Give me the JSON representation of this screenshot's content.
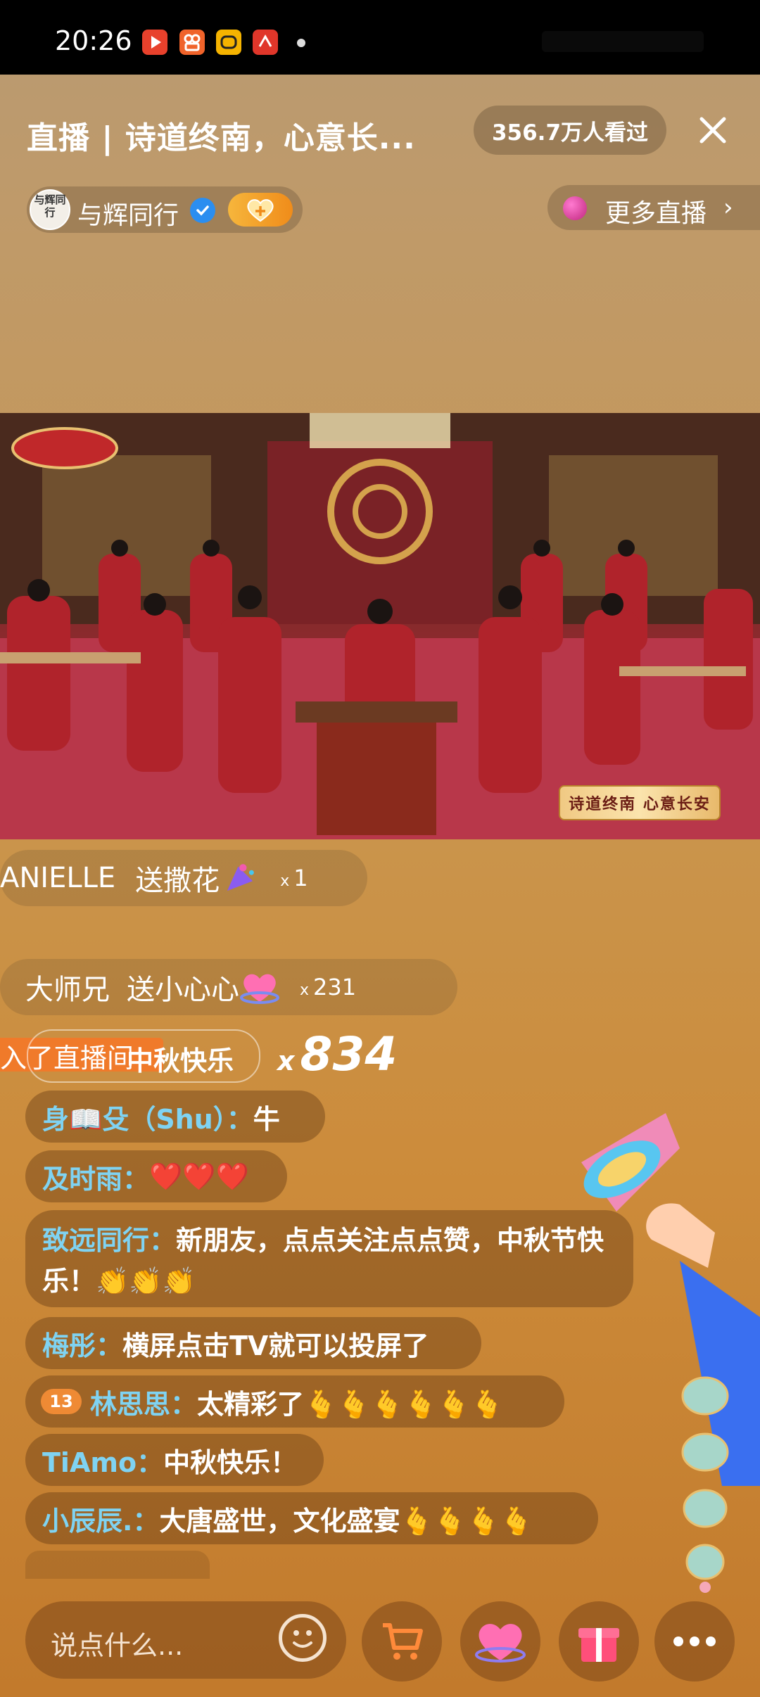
{
  "status_bar": {
    "time": "20:26"
  },
  "header": {
    "title": "直播 | 诗道终南，心意长...",
    "viewers": "356.7万人看过",
    "host": {
      "name": "与辉同行",
      "avatar_text": "与辉同行"
    },
    "more_live": "更多直播",
    "more_live_chevron": "›"
  },
  "video": {
    "caption": "诗道终南 心意长安"
  },
  "gifts": [
    {
      "user": "ANIELLE",
      "action": "送撒花",
      "count_prefix": "x",
      "count": "1"
    },
    {
      "user": "大师兄",
      "action": "送小心心",
      "count_prefix": "x",
      "count": "231"
    }
  ],
  "entry": {
    "text": "入了直播间",
    "pill_text": "中秋快乐",
    "combo_prefix": "x",
    "combo": "834"
  },
  "comments": [
    {
      "name": "身📖殳（Shu）：",
      "text": "牛"
    },
    {
      "name": "及时雨：",
      "text": "❤️❤️❤️"
    },
    {
      "name": "致远同行：",
      "text": "新朋友，点点关注点点赞，中秋节快乐！👏👏👏"
    },
    {
      "name": "梅彤：",
      "text": "横屏点击TV就可以投屏了"
    },
    {
      "level": "13",
      "name": "林思思：",
      "text": "太精彩了🫰🫰🫰🫰🫰🫰"
    },
    {
      "name": "TiAmo：",
      "text": "中秋快乐！"
    },
    {
      "name": "小辰辰.：",
      "text": "大唐盛世，文化盛宴🫰🫰🫰🫰"
    }
  ],
  "bottom_bar": {
    "input_placeholder": "说点什么..."
  },
  "colors": {
    "status_bar": "#000000",
    "name_color": "#7fd3f2",
    "badge_orange": "#ef8a34",
    "verified_blue": "#2b8ef0"
  }
}
